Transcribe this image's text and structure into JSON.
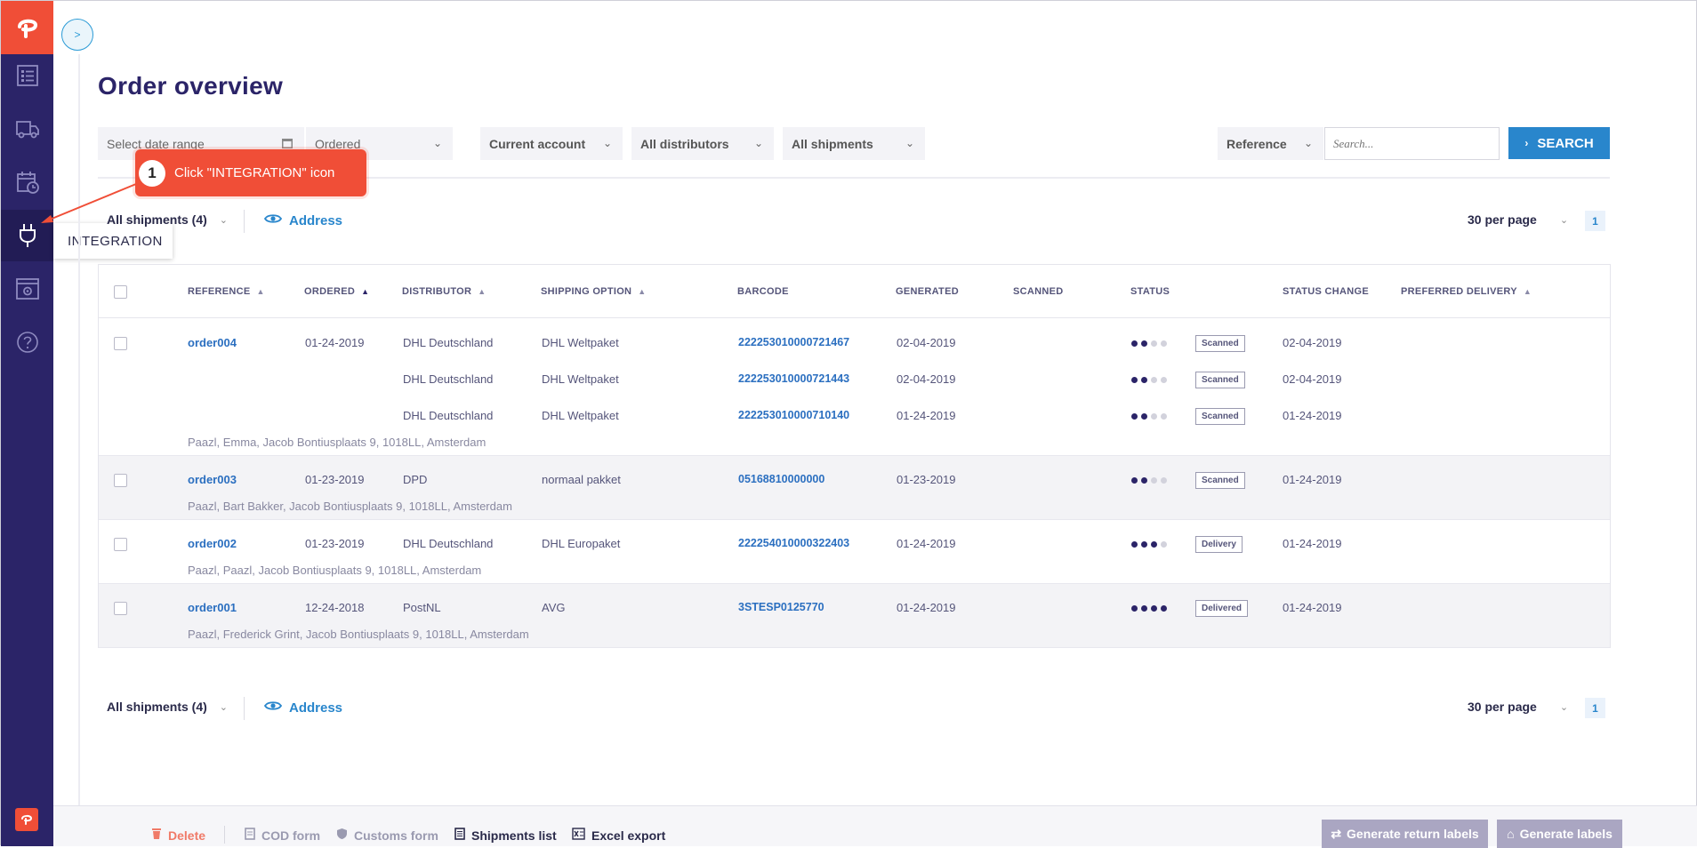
{
  "sidebar": {
    "logo_icon": "paazl-logo-icon",
    "items": [
      {
        "name": "orders-icon"
      },
      {
        "name": "truck-icon"
      },
      {
        "name": "calendar-clock-icon"
      },
      {
        "name": "plug-icon",
        "active": true
      },
      {
        "name": "settings-window-icon"
      },
      {
        "name": "help-icon"
      }
    ]
  },
  "tooltip": {
    "label": "INTEGRATION"
  },
  "toggle": {
    "label": ">"
  },
  "page": {
    "title": "Order overview"
  },
  "filters": {
    "date_range": "Select date range",
    "ordered": "Ordered",
    "account": "Current account",
    "distributors": "All distributors",
    "shipments": "All shipments",
    "reference": "Reference",
    "search_placeholder": "Search...",
    "search_button": "SEARCH"
  },
  "callout": {
    "number": "1",
    "text": "Click \"INTEGRATION\" icon"
  },
  "toolbar": {
    "view": "All shipments (4)",
    "address": "Address",
    "per_page": "30 per page",
    "page": "1"
  },
  "table": {
    "headers": {
      "reference": "REFERENCE",
      "ordered": "ORDERED",
      "distributor": "DISTRIBUTOR",
      "shipping_option": "SHIPPING OPTION",
      "barcode": "BARCODE",
      "generated": "GENERATED",
      "scanned": "SCANNED",
      "status": "STATUS",
      "status_change": "STATUS CHANGE",
      "preferred_delivery": "PREFERRED DELIVERY"
    },
    "orders": [
      {
        "reference": "order004",
        "ordered": "01-24-2019",
        "address": "Paazl, Emma, Jacob Bontiusplaats 9, 1018LL, Amsterdam",
        "shipments": [
          {
            "distributor": "DHL Deutschland",
            "option": "DHL Weltpaket",
            "barcode": "222253010000721467",
            "generated": "02-04-2019",
            "status_steps": 2,
            "status": "Scanned",
            "status_change": "02-04-2019"
          },
          {
            "distributor": "DHL Deutschland",
            "option": "DHL Weltpaket",
            "barcode": "222253010000721443",
            "generated": "02-04-2019",
            "status_steps": 2,
            "status": "Scanned",
            "status_change": "02-04-2019"
          },
          {
            "distributor": "DHL Deutschland",
            "option": "DHL Weltpaket",
            "barcode": "222253010000710140",
            "generated": "01-24-2019",
            "status_steps": 2,
            "status": "Scanned",
            "status_change": "01-24-2019"
          }
        ]
      },
      {
        "reference": "order003",
        "ordered": "01-23-2019",
        "address": "Paazl, Bart Bakker, Jacob Bontiusplaats 9, 1018LL, Amsterdam",
        "shipments": [
          {
            "distributor": "DPD",
            "option": "normaal pakket",
            "barcode": "05168810000000",
            "generated": "01-23-2019",
            "status_steps": 2,
            "status": "Scanned",
            "status_change": "01-24-2019"
          }
        ]
      },
      {
        "reference": "order002",
        "ordered": "01-23-2019",
        "address": "Paazl, Paazl, Jacob Bontiusplaats 9, 1018LL, Amsterdam",
        "shipments": [
          {
            "distributor": "DHL Deutschland",
            "option": "DHL Europaket",
            "barcode": "222254010000322403",
            "generated": "01-24-2019",
            "status_steps": 3,
            "status": "Delivery",
            "status_change": "01-24-2019"
          }
        ]
      },
      {
        "reference": "order001",
        "ordered": "12-24-2018",
        "address": "Paazl, Frederick Grint, Jacob Bontiusplaats 9, 1018LL, Amsterdam",
        "shipments": [
          {
            "distributor": "PostNL",
            "option": "AVG",
            "barcode": "3STESP0125770",
            "generated": "01-24-2019",
            "status_steps": 4,
            "status": "Delivered",
            "status_change": "01-24-2019"
          }
        ]
      }
    ]
  },
  "footer": {
    "delete": "Delete",
    "cod_form": "COD form",
    "customs_form": "Customs form",
    "shipments_list": "Shipments list",
    "excel_export": "Excel export",
    "generate_return_labels": "Generate return labels",
    "generate_labels": "Generate labels"
  },
  "colors": {
    "sidebar": "#2b2468",
    "brand": "#f04e37",
    "accent": "#2986cc"
  }
}
